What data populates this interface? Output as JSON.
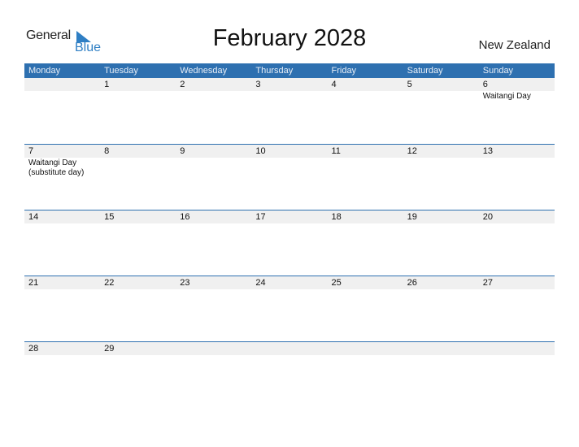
{
  "logo": {
    "line1": "General",
    "line2": "Blue",
    "icon": "triangle-flag-icon"
  },
  "title": "February 2028",
  "country": "New Zealand",
  "colors": {
    "accent": "#2e70b0",
    "date_strip": "#f0f0f0",
    "logo_blue": "#2f7fc4"
  },
  "weekdays": [
    "Monday",
    "Tuesday",
    "Wednesday",
    "Thursday",
    "Friday",
    "Saturday",
    "Sunday"
  ],
  "weeks": [
    {
      "days": [
        "",
        "1",
        "2",
        "3",
        "4",
        "5",
        "6"
      ],
      "events": [
        "",
        "",
        "",
        "",
        "",
        "",
        "Waitangi Day"
      ]
    },
    {
      "days": [
        "7",
        "8",
        "9",
        "10",
        "11",
        "12",
        "13"
      ],
      "events": [
        "Waitangi Day\n(substitute day)",
        "",
        "",
        "",
        "",
        "",
        ""
      ]
    },
    {
      "days": [
        "14",
        "15",
        "16",
        "17",
        "18",
        "19",
        "20"
      ],
      "events": [
        "",
        "",
        "",
        "",
        "",
        "",
        ""
      ]
    },
    {
      "days": [
        "21",
        "22",
        "23",
        "24",
        "25",
        "26",
        "27"
      ],
      "events": [
        "",
        "",
        "",
        "",
        "",
        "",
        ""
      ]
    },
    {
      "days": [
        "28",
        "29",
        "",
        "",
        "",
        "",
        ""
      ],
      "events": [
        "",
        "",
        "",
        "",
        "",
        "",
        ""
      ]
    }
  ]
}
